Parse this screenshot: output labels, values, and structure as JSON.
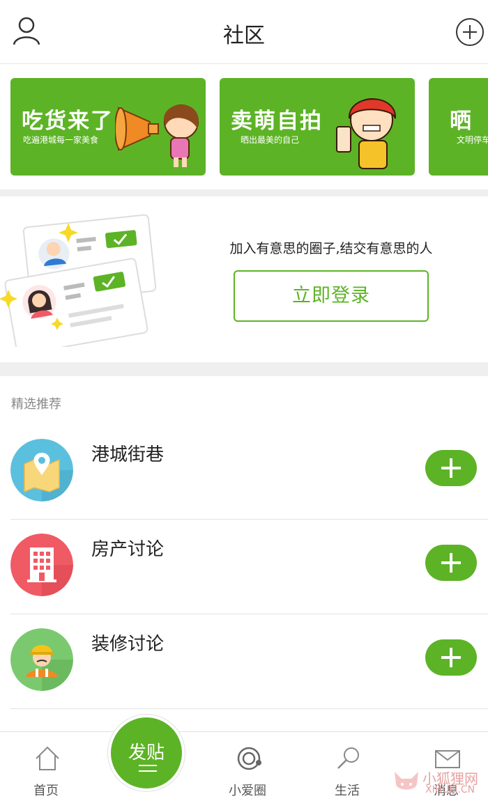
{
  "header": {
    "title": "社区"
  },
  "banners": [
    {
      "title": "吃货来了",
      "subtitle": "吃遍港城每一家美食"
    },
    {
      "title": "卖萌自拍",
      "subtitle": "晒出最美的自己"
    },
    {
      "title": "晒",
      "subtitle": "文明停车"
    }
  ],
  "login_section": {
    "promo_text": "加入有意思的圈子,结交有意思的人",
    "login_button": "立即登录"
  },
  "featured": {
    "label": "精选推荐",
    "items": [
      {
        "name": "港城街巷",
        "icon": "map-pin-icon",
        "color": "#5bc0de"
      },
      {
        "name": "房产讨论",
        "icon": "building-icon",
        "color": "#f05a64"
      },
      {
        "name": "装修讨论",
        "icon": "worker-icon",
        "color": "#7bc96f"
      }
    ]
  },
  "tabbar": {
    "tabs": [
      {
        "label": "首页",
        "icon": "home-icon"
      },
      {
        "label": "小爱圈",
        "icon": "circle-icon"
      },
      {
        "label": "生活",
        "icon": "search-icon"
      },
      {
        "label": "消息",
        "icon": "mail-icon"
      }
    ],
    "post_label": "发贴"
  },
  "watermark": {
    "cn": "小狐狸网",
    "en": "XIHULI.CN"
  },
  "colors": {
    "accent": "#5db326",
    "background": "#ffffff",
    "section_gap": "#efefef"
  }
}
